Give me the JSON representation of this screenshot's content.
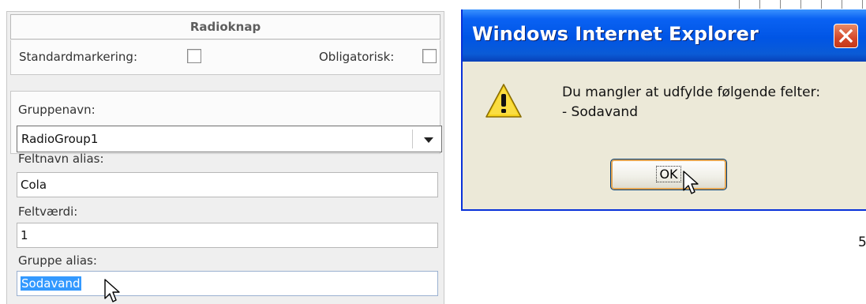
{
  "panel": {
    "title": "Radioknap",
    "default_mark_label": "Standardmarkering:",
    "required_label": "Obligatorisk:",
    "group_name_label": "Gruppenavn:",
    "group_name_value": "RadioGroup1",
    "field_alias_label": "Feltnavn alias:",
    "field_alias_value": "Cola",
    "field_value_label": "Feltværdi:",
    "field_value_value": "1",
    "group_alias_label": "Gruppe alias:",
    "group_alias_value": "Sodavand"
  },
  "dialog": {
    "title": "Windows Internet Explorer",
    "message_line1": "Du mangler at udfylde følgende felter:",
    "message_line2": "- Sodavand",
    "ok_label": "OK"
  },
  "page_number": "5",
  "colors": {
    "titlebar": "#0055e5",
    "close_button": "#d5482a",
    "dialog_bg": "#ece9d8",
    "selection": "#3399ff"
  }
}
